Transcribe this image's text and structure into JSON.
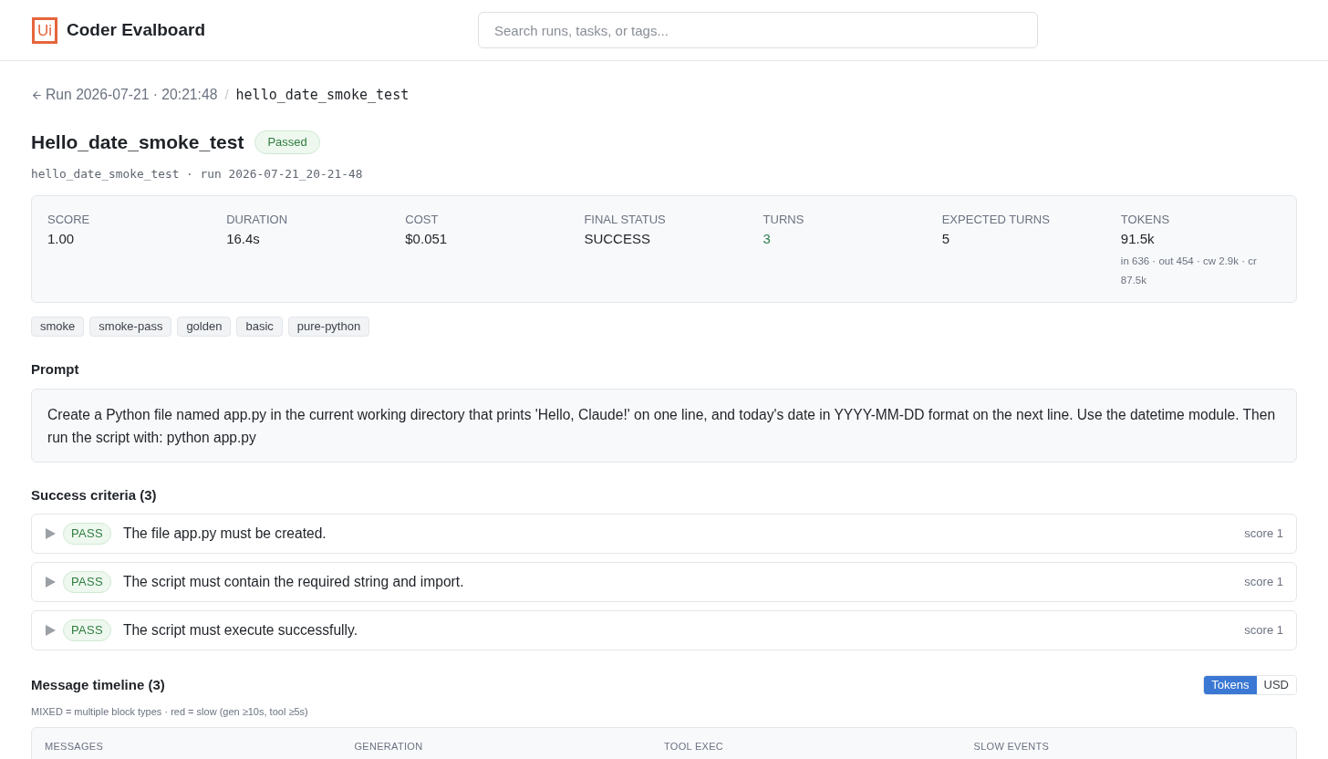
{
  "header": {
    "logo": "Ui",
    "title": "Coder Evalboard",
    "search": {
      "placeholder": "Search runs, tasks, or tags..."
    }
  },
  "breadcrumb": {
    "back_link": "Run 2026-07-21 · 20:21:48",
    "separator": "/",
    "current": "hello_date_smoke_test"
  },
  "task": {
    "title": "Hello_date_smoke_test",
    "status": {
      "label": "Passed",
      "passed": true
    },
    "subtitle": "hello_date_smoke_test · run 2026-07-21_20-21-48"
  },
  "stats": [
    {
      "label": "SCORE",
      "value": "1.00",
      "kind": "plain"
    },
    {
      "label": "DURATION",
      "value": "16.4s",
      "kind": "plain"
    },
    {
      "label": "COST",
      "value": "$0.051",
      "kind": "plain"
    },
    {
      "label": "FINAL STATUS",
      "value": "SUCCESS",
      "kind": "plain"
    },
    {
      "label": "TURNS",
      "value": "3",
      "kind": "positive"
    },
    {
      "label": "EXPECTED TURNS",
      "value": "5",
      "kind": "plain"
    },
    {
      "label": "TOKENS",
      "value": "91.5k",
      "kind": "plain",
      "detail": "in 636 · out 454 · cw 2.9k · cr 87.5k"
    }
  ],
  "tags": [
    "smoke",
    "smoke-pass",
    "golden",
    "basic",
    "pure-python"
  ],
  "prompt": {
    "heading": "Prompt",
    "text": "Create a Python file named app.py in the current working directory that prints 'Hello, Claude!' on one line, and today's date in YYYY-MM-DD format on the next line. Use the datetime module. Then run the script with: python app.py"
  },
  "success_criteria": {
    "heading": "Success criteria (3)",
    "items": [
      {
        "expanded": false,
        "result": {
          "label": "PASS",
          "passed": true
        },
        "text": "The file app.py must be created.",
        "score": "score 1"
      },
      {
        "expanded": false,
        "result": {
          "label": "PASS",
          "passed": true
        },
        "text": "The script must contain the required string and import.",
        "score": "score 1"
      },
      {
        "expanded": false,
        "result": {
          "label": "PASS",
          "passed": true
        },
        "text": "The script must execute successfully.",
        "score": "score 1"
      }
    ]
  },
  "message_timeline": {
    "heading": "Message timeline (3)",
    "units": [
      {
        "label": "Tokens",
        "selected": true
      },
      {
        "label": "USD",
        "selected": false
      }
    ],
    "note": "MIXED = multiple block types · red = slow (gen ≥10s, tool ≥5s)",
    "table": {
      "columns": [
        "MESSAGES",
        "GENERATION",
        "TOOL EXEC",
        "SLOW EVENTS"
      ]
    }
  }
}
